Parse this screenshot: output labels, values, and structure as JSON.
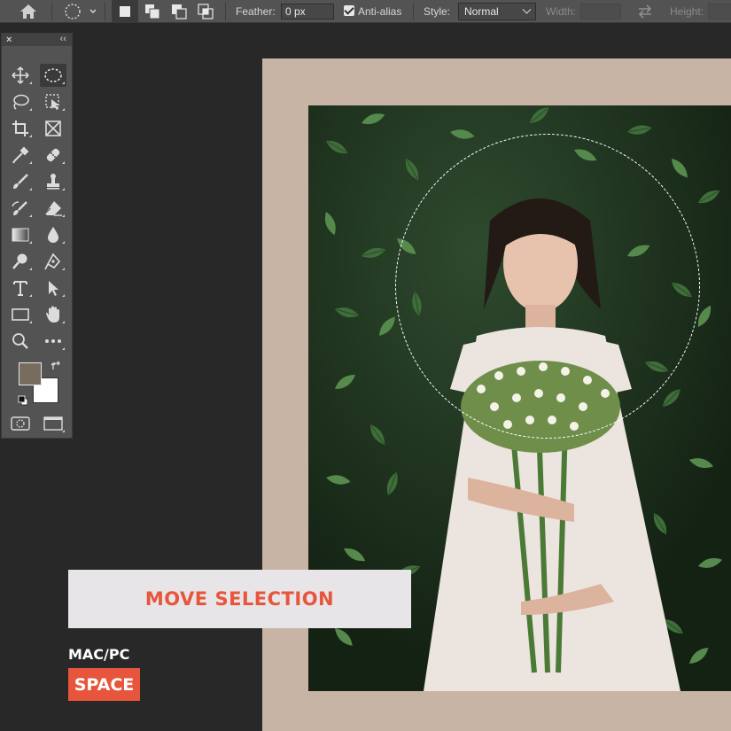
{
  "options_bar": {
    "feather_label": "Feather:",
    "feather_value": "0 px",
    "antialias_label": "Anti-alias",
    "style_label": "Style:",
    "style_value": "Normal",
    "width_label": "Width:",
    "height_label": "Height:",
    "icons": [
      "home-icon",
      "elliptical-marquee-preset-icon",
      "new-selection-icon",
      "add-to-selection-icon",
      "subtract-from-selection-icon",
      "intersect-selection-icon",
      "swap-width-height-icon"
    ]
  },
  "tools_panel": {
    "tools": [
      "move-tool",
      "elliptical-marquee-tool",
      "lasso-tool",
      "object-selection-tool",
      "crop-tool",
      "frame-tool",
      "eyedropper-tool",
      "spot-healing-brush-tool",
      "brush-tool",
      "clone-stamp-tool",
      "history-brush-tool",
      "eraser-tool",
      "gradient-tool",
      "blur-tool",
      "dodge-tool",
      "pen-tool",
      "type-tool",
      "path-selection-tool",
      "rectangle-tool",
      "hand-tool",
      "zoom-tool",
      "edit-toolbar",
      "quick-mask",
      "screen-mode"
    ],
    "foreground_color": "#786c5e",
    "background_color": "#ffffff"
  },
  "canvas": {
    "border_color": "#c8b4a5",
    "selection_shape": "ellipse"
  },
  "caption": {
    "action": "MOVE SELECTION",
    "platform": "MAC/PC",
    "shortcut": "SPACE",
    "accent_color": "#e8553d"
  }
}
